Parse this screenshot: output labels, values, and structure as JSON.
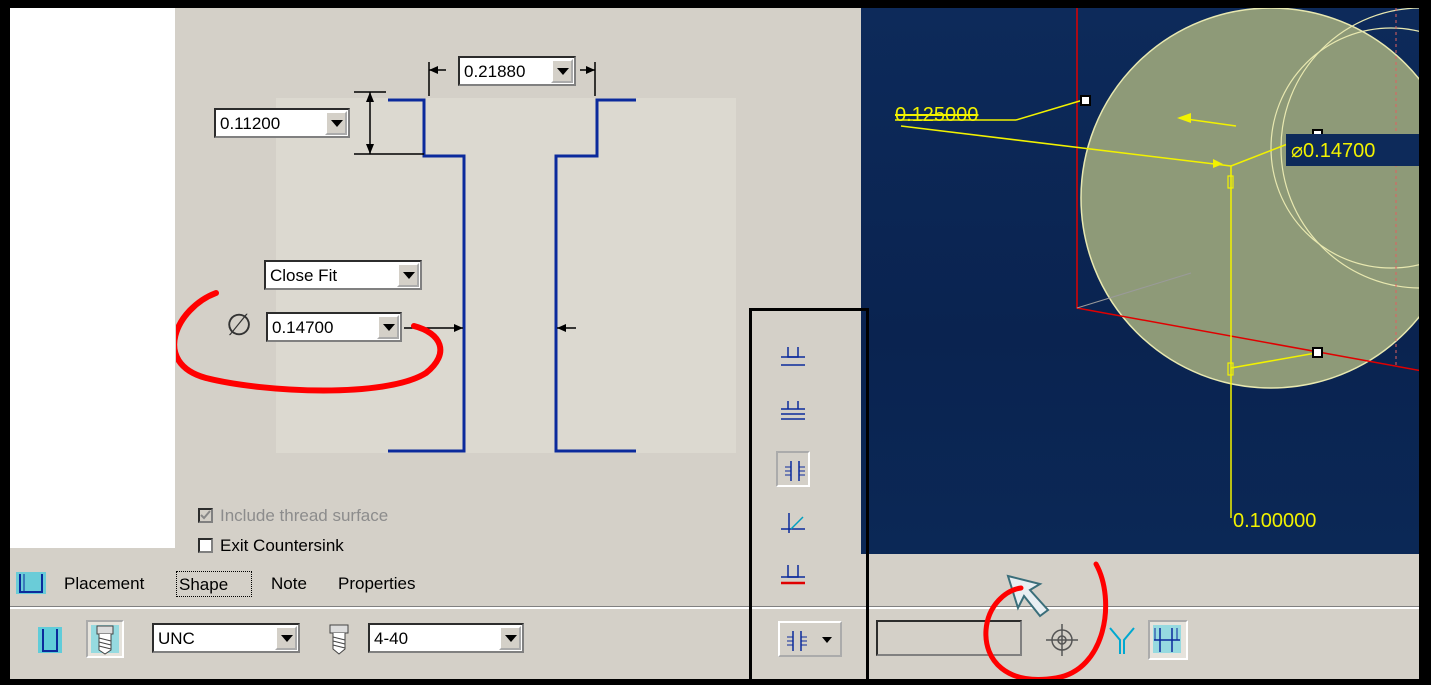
{
  "shape_panel": {
    "top_width": "0.21880",
    "left_depth": "0.11200",
    "fit": "Close Fit",
    "diameter": "0.14700",
    "diameter_symbol": "∅",
    "include_thread_surface": "Include thread surface",
    "include_thread_surface_checked": true,
    "include_thread_surface_disabled": true,
    "exit_countersink": "Exit Countersink",
    "exit_countersink_checked": false
  },
  "tabs": {
    "placement": "Placement",
    "shape": "Shape",
    "note": "Note",
    "properties": "Properties",
    "active": "Shape"
  },
  "toolbar": {
    "thread_series": "UNC",
    "screw_size": "4-40",
    "depth_value": ""
  },
  "viewport": {
    "dim_top": "0.125000",
    "dim_diameter": "⌀0.14700",
    "dim_bottom": "0.100000"
  },
  "colors": {
    "profile_blue": "#0b2a9c",
    "dim_yellow": "#f2f200",
    "annotation_red": "#ff0000",
    "viewport_bg": "#0b2856",
    "icon_cyan": "#00c8e8"
  }
}
